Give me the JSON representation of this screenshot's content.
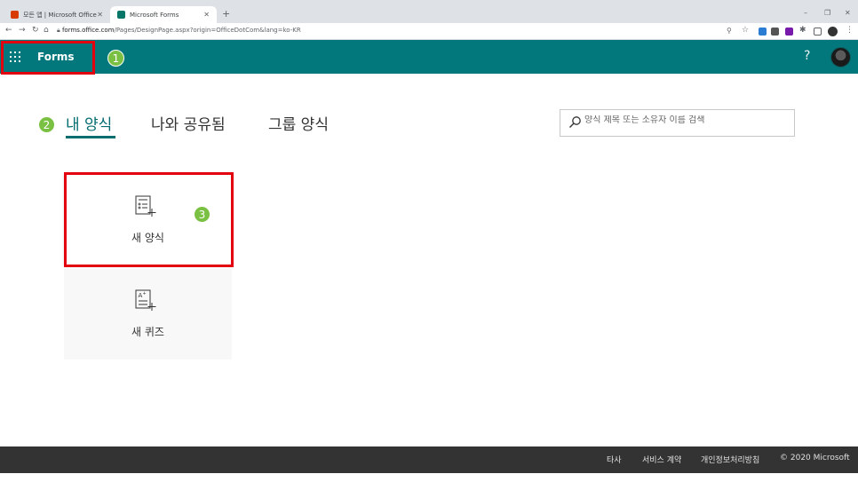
{
  "browser": {
    "tabs": [
      {
        "title": "모든 앱 | Microsoft Office",
        "icon": "office-icon",
        "color": "#d83b01"
      },
      {
        "title": "Microsoft Forms",
        "icon": "forms-icon",
        "color": "#077568"
      }
    ],
    "new_tab": "+",
    "url_host": "forms.office.com",
    "url_path": "/Pages/DesignPage.aspx?origin=OfficeDotCom&lang=ko-KR",
    "window_controls": [
      "–",
      "❐",
      "✕"
    ]
  },
  "header": {
    "app_name": "Forms",
    "help": "?",
    "accent_color": "#03787c"
  },
  "annotations": [
    "1",
    "2",
    "3"
  ],
  "nav": {
    "tabs": [
      {
        "label": "내 양식",
        "active": true
      },
      {
        "label": "나와 공유됨",
        "active": false
      },
      {
        "label": "그룹 양식",
        "active": false
      }
    ]
  },
  "search": {
    "placeholder": "양식 제목 또는 소유자 이름 검색",
    "icon": "search-icon"
  },
  "cards": {
    "new_form": {
      "label": "새 양식",
      "icon": "new-form-icon"
    },
    "new_quiz": {
      "label": "새 퀴즈",
      "icon": "new-quiz-icon"
    }
  },
  "footer": {
    "links": [
      "타사",
      "서비스 계약",
      "개인정보처리방침"
    ],
    "copyright": "© 2020 Microsoft"
  }
}
